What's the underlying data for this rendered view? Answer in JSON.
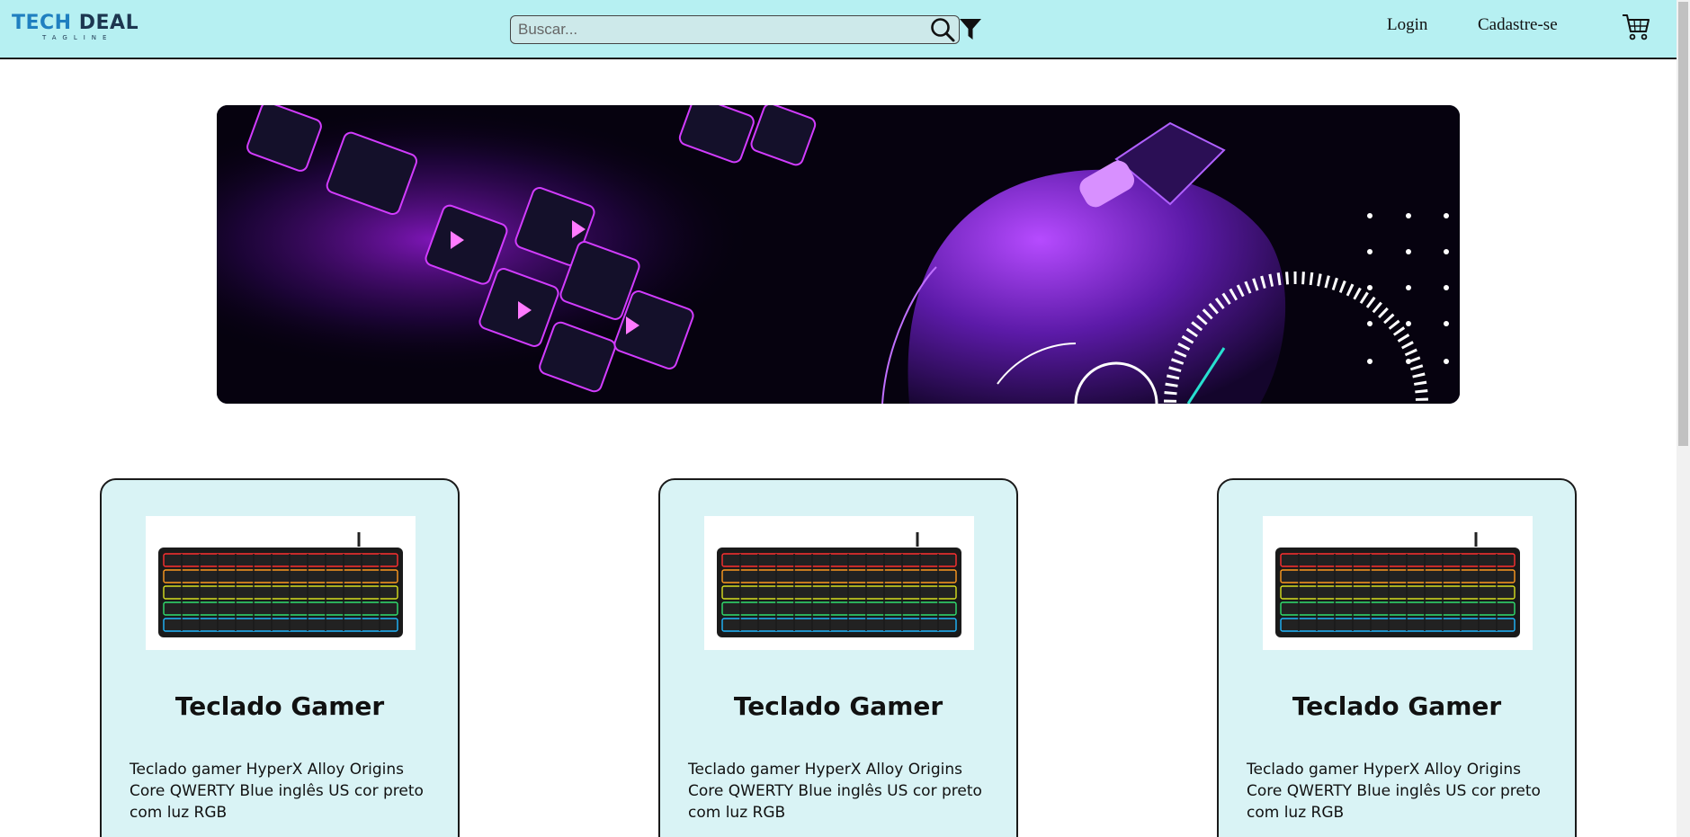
{
  "brand": {
    "name_part1": "TECH",
    "name_part2": "DEAL",
    "tagline": "TAGLINE"
  },
  "search": {
    "placeholder": "Buscar..."
  },
  "nav": {
    "login_label": "Login",
    "signup_label": "Cadastre-se"
  },
  "icons": {
    "search": "search-icon",
    "filter": "filter-icon",
    "cart": "cart-icon"
  },
  "colors": {
    "header_bg": "#b6f0f2",
    "card_bg": "#d9f3f5",
    "brand_blue": "#1f7fc0",
    "banner_accent": "#c020ff"
  },
  "products": [
    {
      "title": "Teclado Gamer",
      "description": "Teclado gamer HyperX Alloy Origins Core QWERTY Blue inglês US cor preto com luz RGB"
    },
    {
      "title": "Teclado Gamer",
      "description": "Teclado gamer HyperX Alloy Origins Core QWERTY Blue inglês US cor preto com luz RGB"
    },
    {
      "title": "Teclado Gamer",
      "description": "Teclado gamer HyperX Alloy Origins Core QWERTY Blue inglês US cor preto com luz RGB"
    }
  ]
}
